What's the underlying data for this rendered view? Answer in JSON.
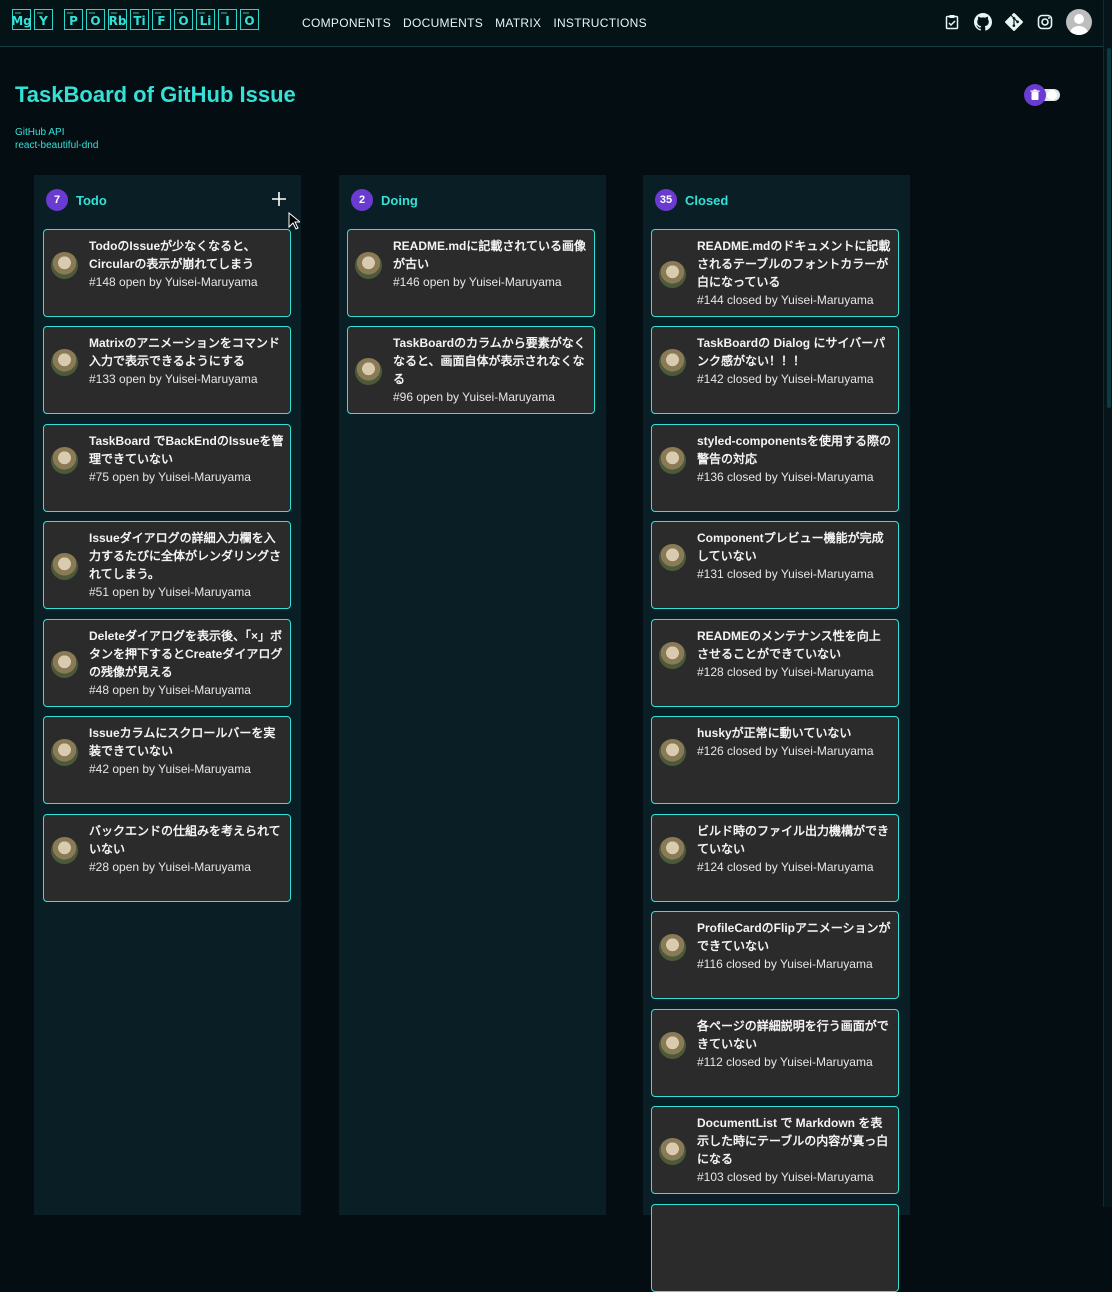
{
  "header": {
    "logo_tiles": [
      "Mg",
      "Y",
      "P",
      "O",
      "Rb",
      "Ti",
      "F",
      "O",
      "Li",
      "I",
      "O"
    ],
    "nav": [
      "COMPONENTS",
      "DOCUMENTS",
      "MATRIX",
      "INSTRUCTIONS"
    ],
    "icons": [
      "task-icon",
      "github-icon",
      "git-icon",
      "instagram-icon",
      "account-icon"
    ]
  },
  "page": {
    "title": "TaskBoard of GitHub Issue",
    "links": [
      "GitHub API",
      "react-beautiful-dnd"
    ]
  },
  "columns": [
    {
      "count": "7",
      "title": "Todo",
      "cards": [
        {
          "title": "TodoのIssueが少なくなると、Circularの表示が崩れてしまう",
          "meta": "#148 open by Yuisei-Maruyama"
        },
        {
          "title": "Matrixのアニメーションをコマンド入力で表示できるようにする",
          "meta": "#133 open by Yuisei-Maruyama"
        },
        {
          "title": "TaskBoard でBackEndのIssueを管理できていない",
          "meta": "#75 open by Yuisei-Maruyama"
        },
        {
          "title": "Issueダイアログの詳細入力欄を入力するたびに全体がレンダリングされてしまう。",
          "meta": "#51 open by Yuisei-Maruyama"
        },
        {
          "title": "Deleteダイアログを表示後、「×」ボタンを押下するとCreateダイアログの残像が見える",
          "meta": "#48 open by Yuisei-Maruyama"
        },
        {
          "title": "Issueカラムにスクロールバーを実装できていない",
          "meta": "#42 open by Yuisei-Maruyama"
        },
        {
          "title": "バックエンドの仕組みを考えられていない",
          "meta": "#28 open by Yuisei-Maruyama"
        }
      ]
    },
    {
      "count": "2",
      "title": "Doing",
      "cards": [
        {
          "title": "README.mdに記載されている画像が古い",
          "meta": "#146 open by Yuisei-Maruyama"
        },
        {
          "title": "TaskBoardのカラムから要素がなくなると、画面自体が表示されなくなる",
          "meta": "#96 open by Yuisei-Maruyama"
        }
      ]
    },
    {
      "count": "35",
      "title": "Closed",
      "cards": [
        {
          "title": "README.mdのドキュメントに記載されるテーブルのフォントカラーが白になっている",
          "meta": "#144 closed by Yuisei-Maruyama"
        },
        {
          "title": "TaskBoardの Dialog にサイバーパンク感がない！！！",
          "meta": "#142 closed by Yuisei-Maruyama"
        },
        {
          "title": "styled-componentsを使用する際の警告の対応",
          "meta": "#136 closed by Yuisei-Maruyama"
        },
        {
          "title": "Componentプレビュー機能が完成していない",
          "meta": "#131 closed by Yuisei-Maruyama"
        },
        {
          "title": "READMEのメンテナンス性を向上させることができていない",
          "meta": "#128 closed by Yuisei-Maruyama"
        },
        {
          "title": "huskyが正常に動いていない",
          "meta": "#126 closed by Yuisei-Maruyama"
        },
        {
          "title": "ビルド時のファイル出力機構ができていない",
          "meta": "#124 closed by Yuisei-Maruyama"
        },
        {
          "title": "ProfileCardのFlipアニメーションができていない",
          "meta": "#116 closed by Yuisei-Maruyama"
        },
        {
          "title": "各ページの詳細説明を行う画面ができていない",
          "meta": "#112 closed by Yuisei-Maruyama"
        },
        {
          "title": "DocumentList で Markdown を表示した時にテーブルの内容が真っ白になる",
          "meta": "#103 closed by Yuisei-Maruyama"
        }
      ]
    }
  ],
  "colors": {
    "accent": "#35e0d6",
    "badge": "#6a3bd1",
    "card": "#2b2b2b",
    "bg": "#040e12"
  }
}
